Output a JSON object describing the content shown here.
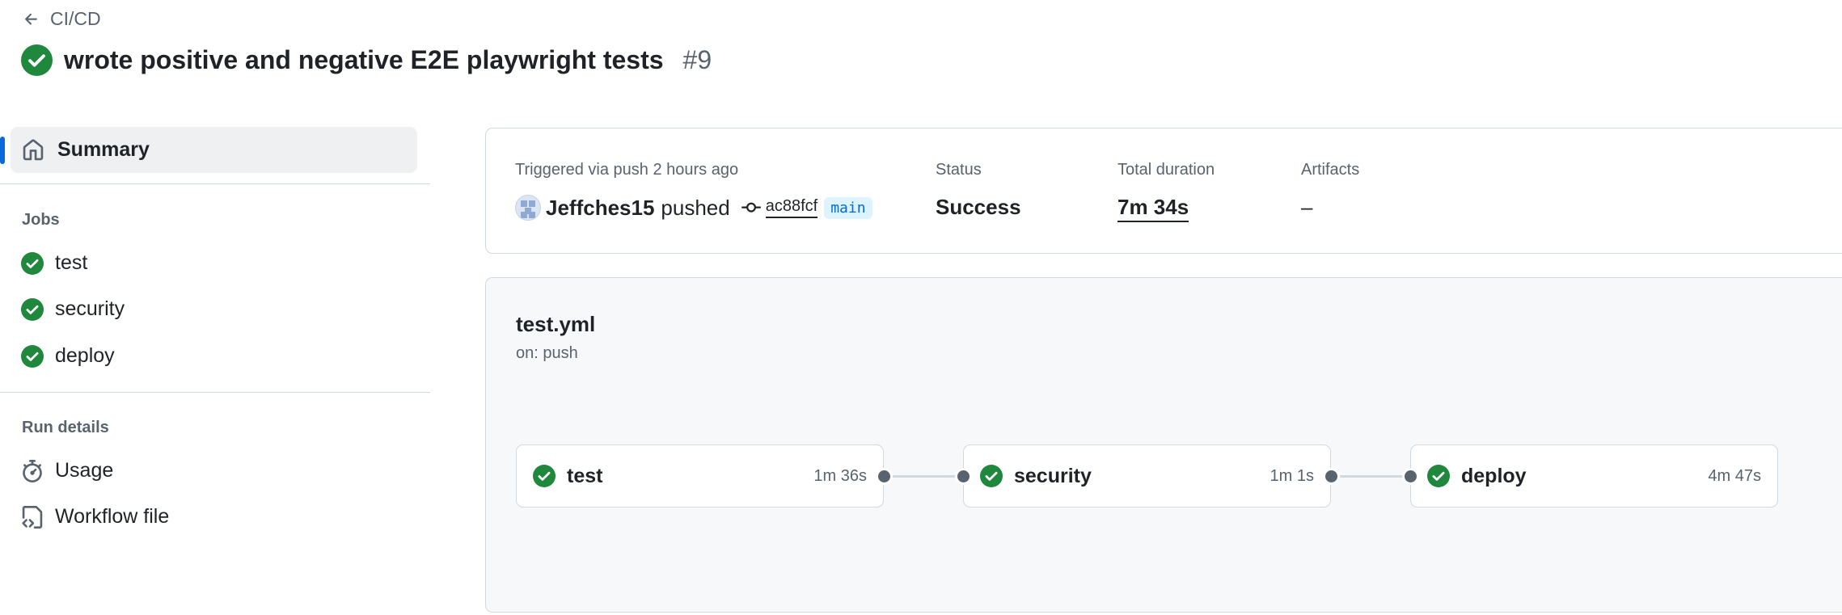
{
  "breadcrumb": {
    "back_label": "CI/CD"
  },
  "header": {
    "title": "wrote positive and negative E2E playwright tests",
    "run_number": "#9",
    "status_icon": "check-circle-fill-icon",
    "status_color": "#1f883d"
  },
  "sidebar": {
    "summary_label": "Summary",
    "jobs_heading": "Jobs",
    "jobs": [
      {
        "label": "test",
        "status": "success"
      },
      {
        "label": "security",
        "status": "success"
      },
      {
        "label": "deploy",
        "status": "success"
      }
    ],
    "run_details_heading": "Run details",
    "run_details": [
      {
        "label": "Usage",
        "icon": "stopwatch-icon"
      },
      {
        "label": "Workflow file",
        "icon": "file-code-icon"
      }
    ]
  },
  "summary": {
    "trigger_label": "Triggered via push 2 hours ago",
    "actor": "Jeffches15",
    "action": "pushed",
    "commit_sha": "ac88fcf",
    "branch": "main",
    "status_label": "Status",
    "status_value": "Success",
    "duration_label": "Total duration",
    "duration_value": "7m 34s",
    "artifacts_label": "Artifacts",
    "artifacts_value": "–"
  },
  "workflow": {
    "file": "test.yml",
    "trigger": "on: push",
    "jobs": [
      {
        "name": "test",
        "duration": "1m 36s"
      },
      {
        "name": "security",
        "duration": "1m 1s"
      },
      {
        "name": "deploy",
        "duration": "4m 47s"
      }
    ]
  },
  "colors": {
    "success": "#1f883d",
    "accent": "#0969da",
    "muted": "#59636e"
  }
}
